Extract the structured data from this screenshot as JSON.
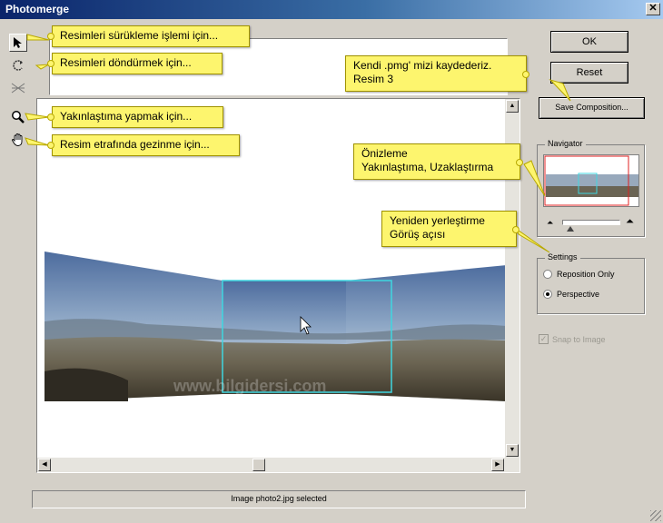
{
  "window": {
    "title": "Photomerge",
    "close_label": "✕"
  },
  "toolbar": {
    "tools": [
      {
        "name": "select-image-tool",
        "icon": "arrow-cursor-icon"
      },
      {
        "name": "rotate-image-tool",
        "icon": "rotate-icon"
      },
      {
        "name": "set-vanishing-point-tool",
        "icon": "vanishing-point-icon"
      },
      {
        "name": "zoom-tool",
        "icon": "magnifier-icon"
      },
      {
        "name": "hand-tool",
        "icon": "hand-icon"
      }
    ]
  },
  "buttons": {
    "ok": "OK",
    "reset": "Reset",
    "save_composition": "Save Composition..."
  },
  "navigator": {
    "title": "Navigator"
  },
  "settings": {
    "title": "Settings",
    "options": [
      {
        "label": "Reposition Only",
        "selected": false
      },
      {
        "label": "Perspective",
        "selected": true
      }
    ],
    "snap_to_image": {
      "label": "Snap to Image",
      "checked": true,
      "enabled": false
    }
  },
  "status": {
    "text": "Image photo2.jpg selected"
  },
  "annotations": {
    "select": "Resimleri sürükleme işlemi için...",
    "rotate": "Resimleri döndürmek için...",
    "zoom": "Yakınlaştıma yapmak için...",
    "hand": "Resim etrafında gezinme için...",
    "save_line1": "Kendi .pmg' mizi kaydederiz.",
    "save_line2": "Resim 3",
    "preview_line1": "Önizleme",
    "preview_line2": "Yakınlaştıma, Uzaklaştırma",
    "reposition_line1": "Yeniden yerleştirme",
    "reposition_line2": "Görüş açısı"
  },
  "watermark": "www.bilgidersi.com",
  "colors": {
    "callout": "#fdf56e",
    "selection": "#3fd6e0",
    "titlebar": "#0a246a"
  }
}
